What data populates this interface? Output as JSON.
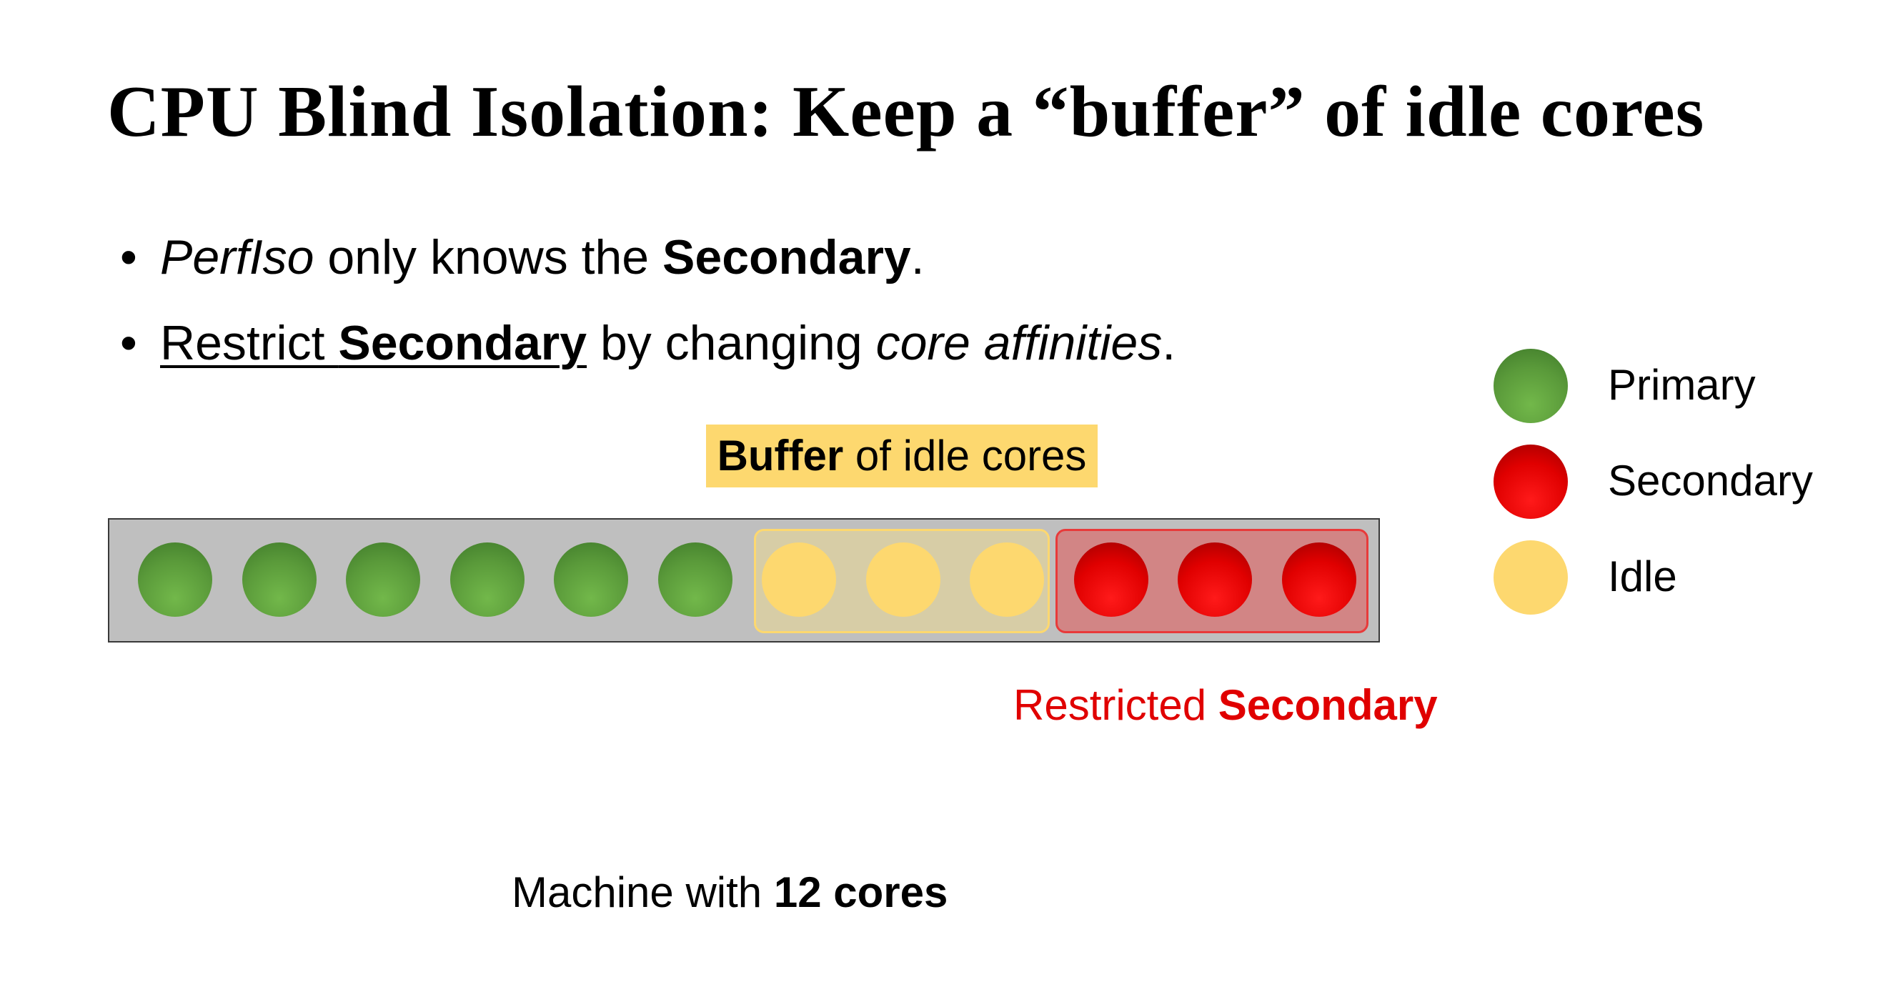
{
  "title": "CPU Blind Isolation: Keep a “buffer” of idle cores",
  "bullets": [
    {
      "marker": "•",
      "part1_italic": "PerfIso",
      "part2": " only knows the ",
      "part3_bold": "Secondary",
      "part4": "."
    },
    {
      "marker": "•",
      "part1_underline": "Restrict ",
      "part2_bold_underline": "Secondary",
      "part3": " by changing ",
      "part4_italic": "core affinities",
      "part5": "."
    }
  ],
  "buffer_label": {
    "bold": "Buffer",
    "rest": " of idle cores"
  },
  "cores": [
    "primary",
    "primary",
    "primary",
    "primary",
    "primary",
    "primary",
    "idle",
    "idle",
    "idle",
    "secondary",
    "secondary",
    "secondary"
  ],
  "restricted_label": {
    "plain": "Restricted ",
    "bold": "Secondary"
  },
  "machine_label": {
    "plain": "Machine with ",
    "bold": "12 cores"
  },
  "legend": [
    {
      "key": "primary",
      "label": "Primary"
    },
    {
      "key": "secondary",
      "label": "Secondary"
    },
    {
      "key": "idle",
      "label": "Idle"
    }
  ],
  "colors": {
    "primary": "#5a9a3a",
    "secondary": "#e00000",
    "idle": "#fdd86f",
    "machine_bg": "#bfbfbf",
    "restricted_text": "#e00000"
  }
}
